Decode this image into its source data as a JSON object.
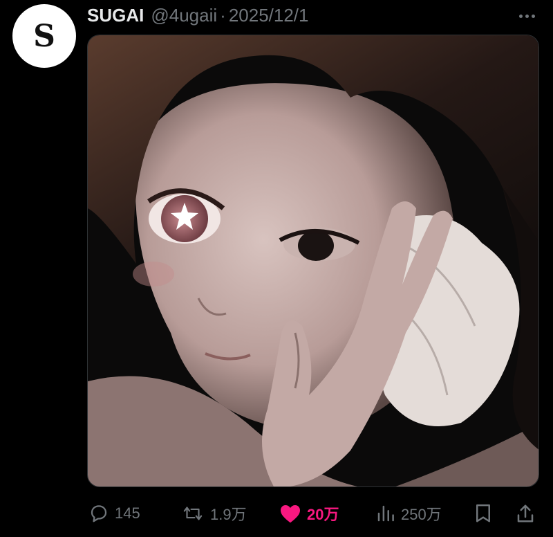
{
  "author": {
    "avatar_letter": "S",
    "name": "SUGAI",
    "handle": "@4ugaii",
    "separator": "·",
    "date": "2025/12/1"
  },
  "actions": {
    "reply": {
      "icon": "reply-icon",
      "count": "145"
    },
    "repost": {
      "icon": "repost-icon",
      "count": "1.9万"
    },
    "like": {
      "icon": "heart-icon",
      "count": "20万",
      "color": "#f91880"
    },
    "views": {
      "icon": "views-icon",
      "count": "250万"
    },
    "bookmark": {
      "icon": "bookmark-icon"
    },
    "share": {
      "icon": "share-icon"
    }
  },
  "colors": {
    "background": "#000000",
    "muted": "#71767b",
    "like": "#f91880"
  }
}
